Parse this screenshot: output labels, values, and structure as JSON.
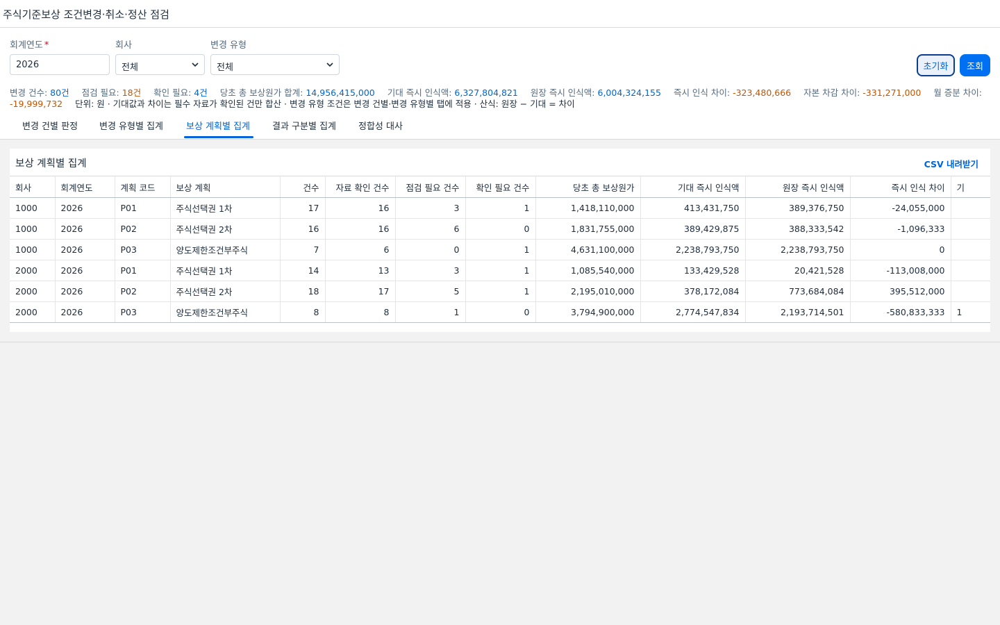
{
  "page": {
    "title": "주식기준보상 조건변경·취소·정산 점검"
  },
  "filters": {
    "year": {
      "label": "회계연도",
      "value": "2026"
    },
    "company": {
      "label": "회사",
      "value": "전체"
    },
    "change_type": {
      "label": "변경 유형",
      "value": "전체"
    },
    "reset_label": "초기화",
    "query_label": "조회"
  },
  "summary": {
    "change_count_label": "변경 건수:",
    "change_count": "80건",
    "check_needed_label": "점검 필요:",
    "check_needed": "18건",
    "confirm_needed_label": "확인 필요:",
    "confirm_needed": "4건",
    "total_cost_label": "당초 총 보상원가 합계:",
    "total_cost": "14,956,415,000",
    "expected_label": "기대 즉시 인식액:",
    "expected": "6,327,804,821",
    "ledger_label": "원장 즉시 인식액:",
    "ledger": "6,004,324,155",
    "immediate_diff_label": "즉시 인식 차이:",
    "immediate_diff": "-323,480,666",
    "capital_diff_label": "자본 차감 차이:",
    "capital_diff": "-331,271,000",
    "monthly_diff_label": "월 증분 차이:",
    "monthly_diff": "-19,999,732",
    "note": "단위: 원 · 기대값과 차이는 필수 자료가 확인된 건만 합산 · 변경 유형 조건은 변경 건별·변경 유형별 탭에 적용 · 산식: 원장 − 기대 = 차이"
  },
  "tabs": [
    {
      "label": "변경 건별 판정"
    },
    {
      "label": "변경 유형별 집계"
    },
    {
      "label": "보상 계획별 집계"
    },
    {
      "label": "결과 구분별 집계"
    },
    {
      "label": "정합성 대사"
    }
  ],
  "panel": {
    "title": "보상 계획별 집계",
    "csv_label": "CSV 내려받기"
  },
  "table": {
    "columns": [
      "회사",
      "회계연도",
      "계획 코드",
      "보상 계획",
      "건수",
      "자료 확인 건수",
      "점검 필요 건수",
      "확인 필요 건수",
      "당초 총 보상원가",
      "기대 즉시 인식액",
      "원장 즉시 인식액",
      "즉시 인식 차이",
      "기"
    ],
    "rows": [
      [
        "1000",
        "2026",
        "P01",
        "주식선택권 1차",
        "17",
        "16",
        "3",
        "1",
        "1,418,110,000",
        "413,431,750",
        "389,376,750",
        "-24,055,000",
        ""
      ],
      [
        "1000",
        "2026",
        "P02",
        "주식선택권 2차",
        "16",
        "16",
        "6",
        "0",
        "1,831,755,000",
        "389,429,875",
        "388,333,542",
        "-1,096,333",
        ""
      ],
      [
        "1000",
        "2026",
        "P03",
        "양도제한조건부주식",
        "7",
        "6",
        "0",
        "1",
        "4,631,100,000",
        "2,238,793,750",
        "2,238,793,750",
        "0",
        ""
      ],
      [
        "2000",
        "2026",
        "P01",
        "주식선택권 1차",
        "14",
        "13",
        "3",
        "1",
        "1,085,540,000",
        "133,429,528",
        "20,421,528",
        "-113,008,000",
        ""
      ],
      [
        "2000",
        "2026",
        "P02",
        "주식선택권 2차",
        "18",
        "17",
        "5",
        "1",
        "2,195,010,000",
        "378,172,084",
        "773,684,084",
        "395,512,000",
        ""
      ],
      [
        "2000",
        "2026",
        "P03",
        "양도제한조건부주식",
        "8",
        "8",
        "1",
        "0",
        "3,794,900,000",
        "2,774,547,834",
        "2,193,714,501",
        "-580,833,333",
        "1"
      ]
    ]
  }
}
